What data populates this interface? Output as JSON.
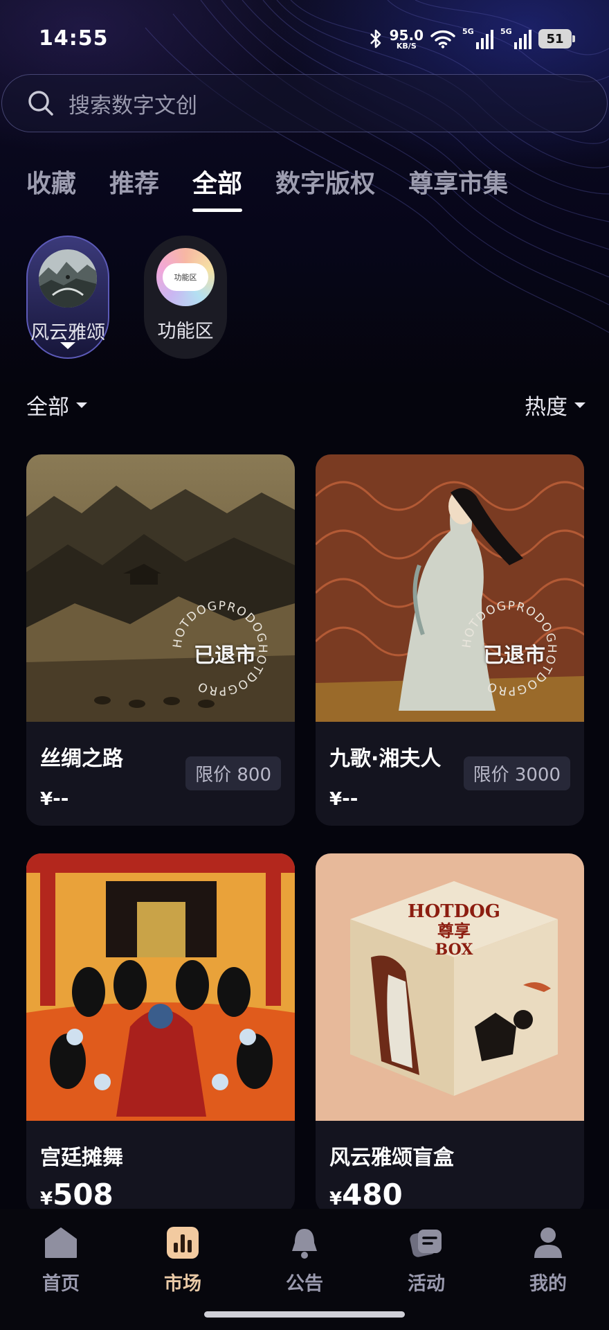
{
  "status_bar": {
    "time": "14:55",
    "net_speed": "95.0",
    "net_unit": "KB/S",
    "signal_1": "5G",
    "signal_2": "5G",
    "battery": "51",
    "icons": [
      "bluetooth-icon",
      "wifi-icon",
      "signal-icon",
      "battery-icon"
    ]
  },
  "search": {
    "placeholder": "搜索数字文创",
    "icon": "search-icon"
  },
  "tabs": [
    {
      "label": "收藏",
      "active": false
    },
    {
      "label": "推荐",
      "active": false
    },
    {
      "label": "全部",
      "active": true
    },
    {
      "label": "数字版权",
      "active": false
    },
    {
      "label": "尊享市集",
      "active": false
    }
  ],
  "series": [
    {
      "label": "风云雅颂",
      "active": true
    },
    {
      "label": "功能区",
      "active": false,
      "thumb_text": "功能区"
    }
  ],
  "filters": {
    "category": "全部",
    "sort": "热度"
  },
  "stamp": {
    "ring_text": "HOTDOGPRODOGHOTDOGPRO",
    "label": "已退市"
  },
  "cards": [
    {
      "title": "丝绸之路",
      "price_symbol": "¥",
      "price": "--",
      "limit": "限价 800",
      "delisted": true
    },
    {
      "title": "九歌·湘夫人",
      "price_symbol": "¥",
      "price": "--",
      "limit": "限价 3000",
      "delisted": true
    },
    {
      "title": "宫廷摊舞",
      "price_symbol": "¥",
      "price": "508",
      "limit": "",
      "delisted": false
    },
    {
      "title": "风云雅颂盲盒",
      "price_symbol": "¥",
      "price": "480",
      "limit": "",
      "delisted": false,
      "box_text_1": "HOTDOG",
      "box_text_2": "尊享",
      "box_text_3": "BOX"
    }
  ],
  "bottom_nav": [
    {
      "label": "首页",
      "icon": "home-icon",
      "active": false
    },
    {
      "label": "市场",
      "icon": "market-icon",
      "active": true
    },
    {
      "label": "公告",
      "icon": "bell-icon",
      "active": false
    },
    {
      "label": "活动",
      "icon": "activity-icon",
      "active": false
    },
    {
      "label": "我的",
      "icon": "profile-icon",
      "active": false
    }
  ],
  "colors": {
    "background": "#05050d",
    "accent": "#e9c9a6",
    "active_chip": "#3b3a7a"
  }
}
